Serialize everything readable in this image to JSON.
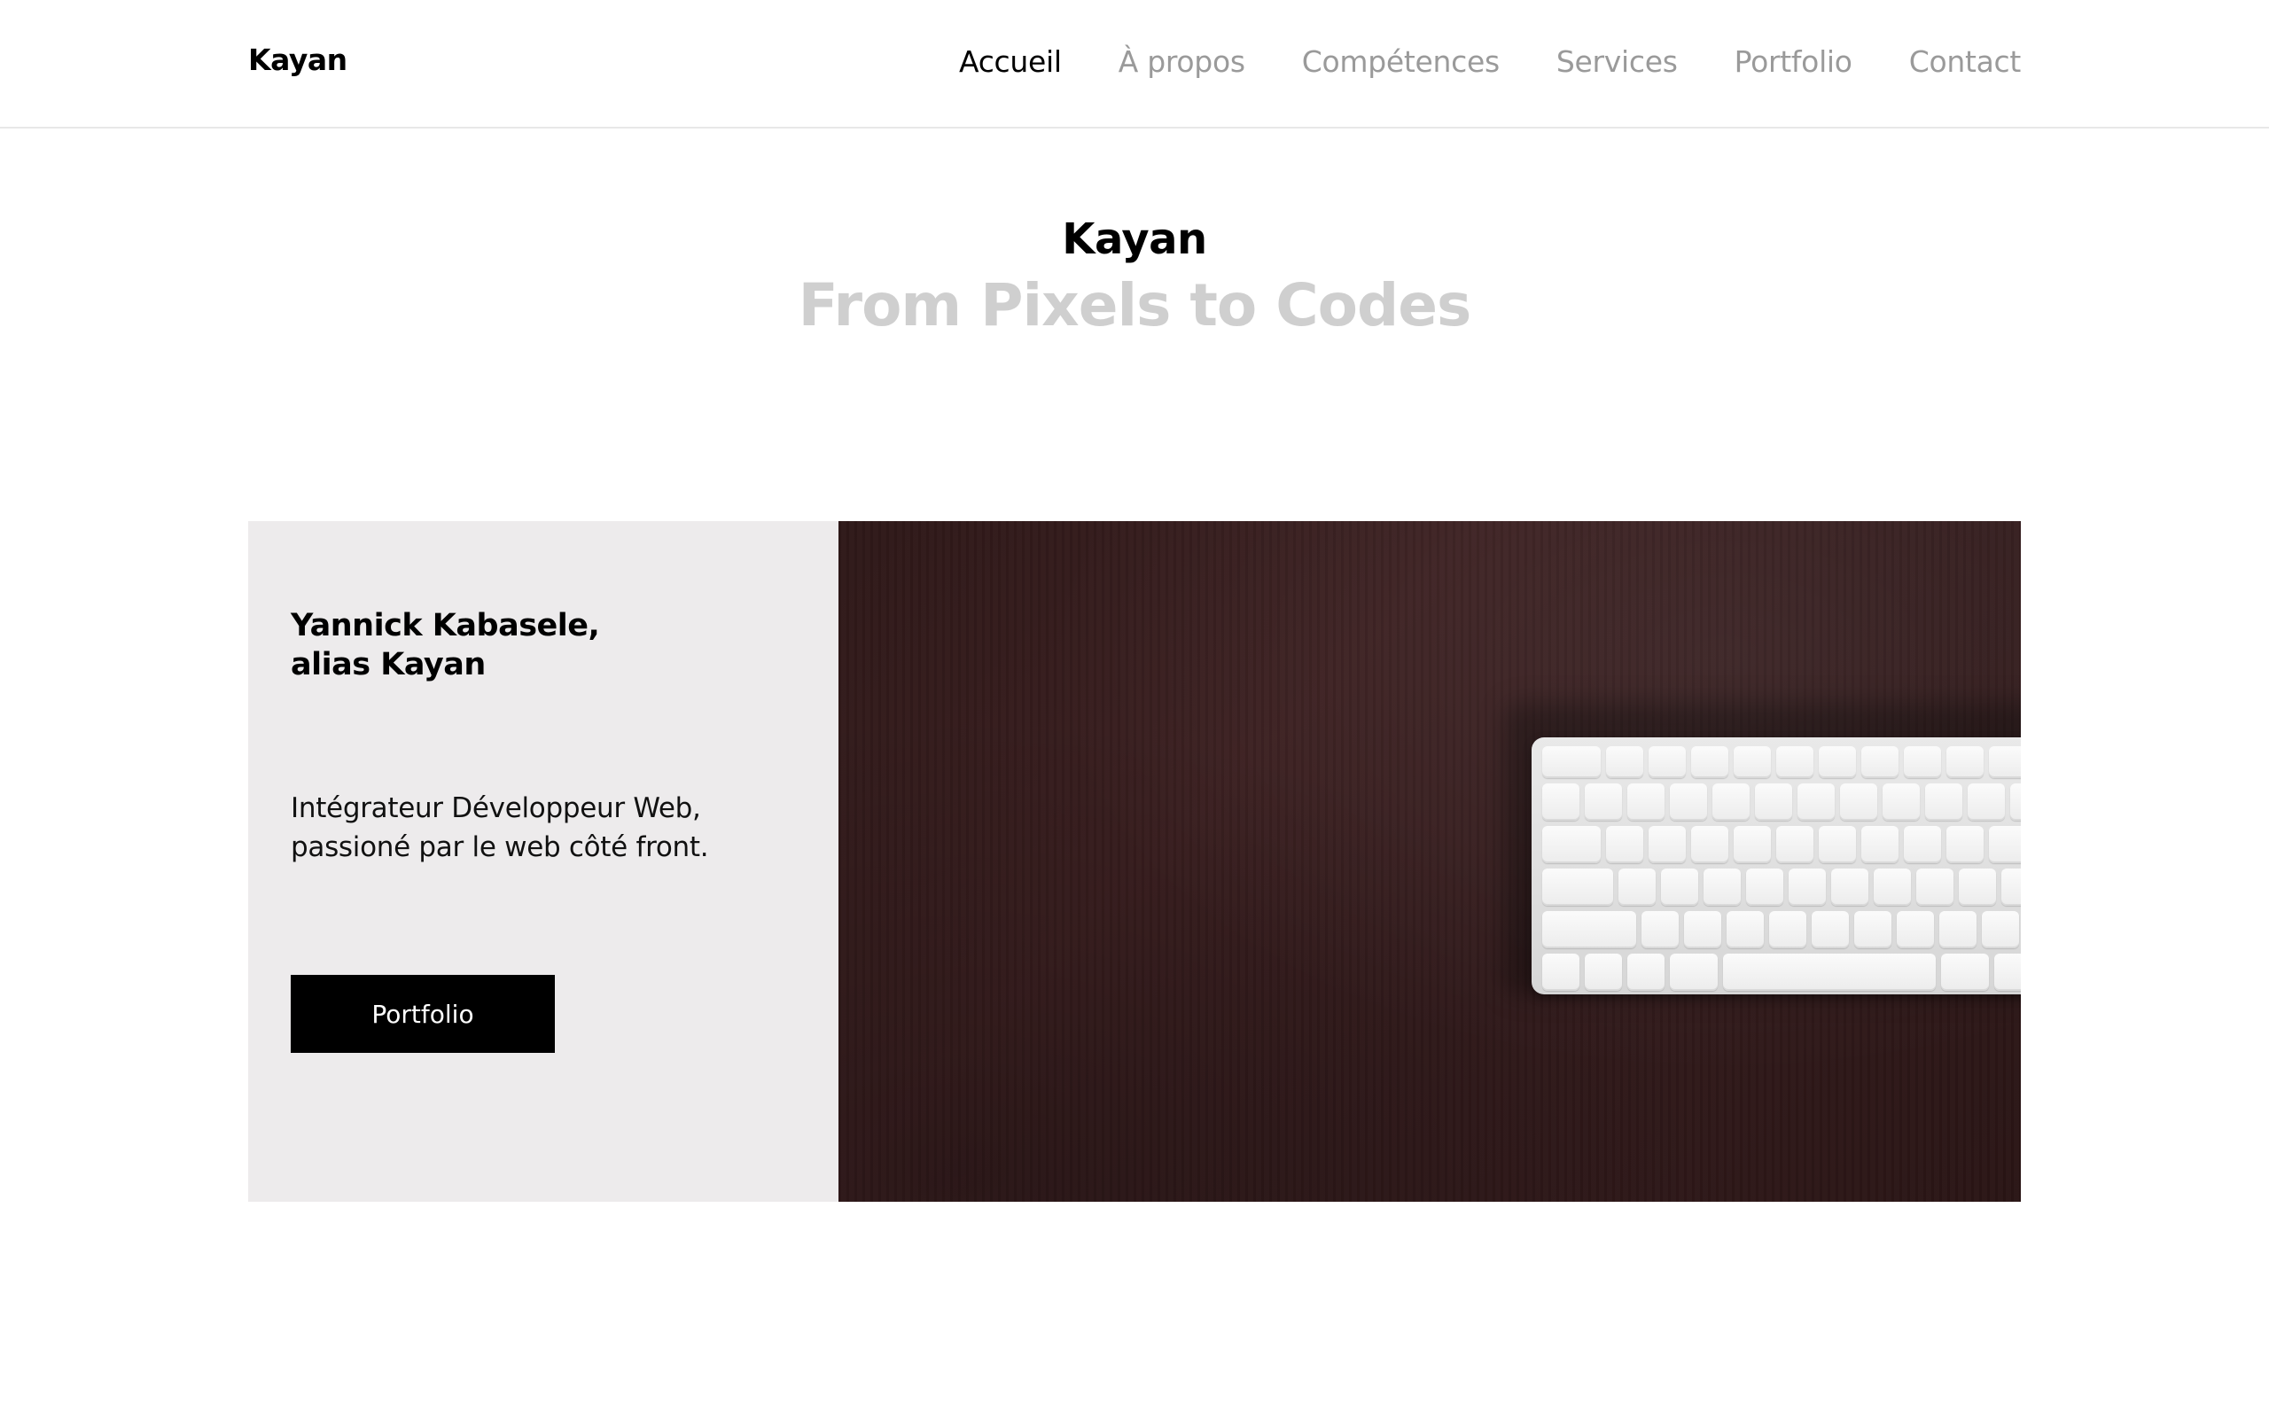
{
  "header": {
    "brand": "Kayan",
    "nav": [
      {
        "label": "Accueil",
        "active": true
      },
      {
        "label": "À propos",
        "active": false
      },
      {
        "label": "Compétences",
        "active": false
      },
      {
        "label": "Services",
        "active": false
      },
      {
        "label": "Portfolio",
        "active": false
      },
      {
        "label": "Contact",
        "active": false
      }
    ]
  },
  "hero": {
    "title": "Kayan",
    "subtitle": "From Pixels to Codes"
  },
  "intro": {
    "name_line1": "Yannick Kabasele,",
    "name_line2": "alias Kayan",
    "desc_line1": "Intégrateur Développeur Web,",
    "desc_line2": "passioné par le web côté front.",
    "button_label": "Portfolio",
    "image_icon": "keyboard-photo"
  },
  "colors": {
    "nav_inactive": "#9a9a9a",
    "nav_active": "#000000",
    "subtitle": "#cfcfcf",
    "card_left_bg": "#edebec",
    "button_bg": "#000000",
    "photo_bg": "#341b1c"
  }
}
